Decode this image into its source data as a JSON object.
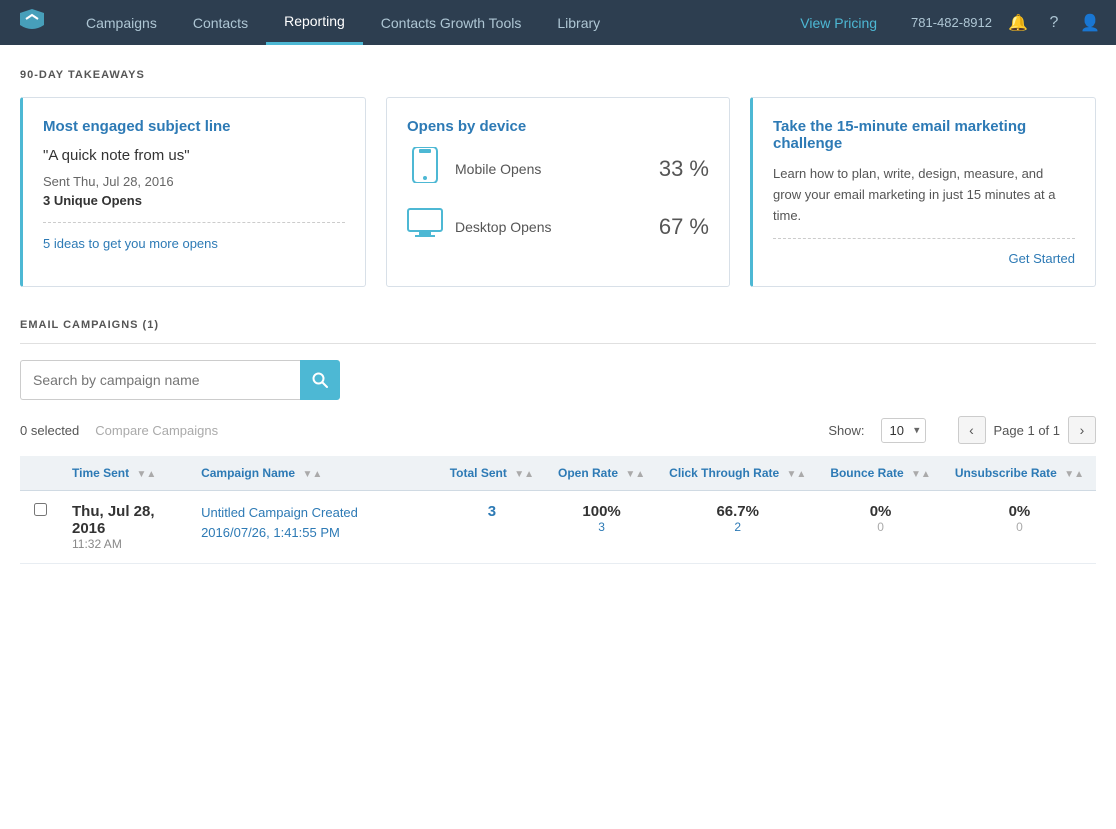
{
  "nav": {
    "logo_alt": "logo",
    "items": [
      {
        "label": "Campaigns",
        "active": false
      },
      {
        "label": "Contacts",
        "active": false
      },
      {
        "label": "Reporting",
        "active": true
      },
      {
        "label": "Contacts Growth Tools",
        "active": false
      },
      {
        "label": "Library",
        "active": false
      }
    ],
    "pricing_label": "View Pricing",
    "phone": "781-482-8912",
    "icons": [
      "bell",
      "question",
      "user"
    ]
  },
  "takeaways": {
    "section_title": "90-DAY TAKEAWAYS",
    "card1": {
      "title": "Most engaged subject line",
      "subject": "\"A quick note from us\"",
      "sent_label": "Sent Thu, Jul 28, 2016",
      "opens_label": "3 Unique Opens",
      "link": "5 ideas to get you more opens"
    },
    "card2": {
      "title": "Opens by device",
      "mobile_label": "Mobile Opens",
      "mobile_pct": "33 %",
      "desktop_label": "Desktop Opens",
      "desktop_pct": "67 %"
    },
    "card3": {
      "title": "Take the 15-minute email marketing challenge",
      "desc": "Learn how to plan, write, design, measure, and grow your email marketing in just 15 minutes at a time.",
      "link": "Get Started"
    }
  },
  "email_campaigns": {
    "section_title": "EMAIL CAMPAIGNS (1)",
    "search_placeholder": "Search by campaign name",
    "selected_count": "0 selected",
    "compare_label": "Compare Campaigns",
    "show_label": "Show:",
    "show_value": "10",
    "page_info": "Page 1 of 1",
    "columns": [
      {
        "label": "Time Sent",
        "sortable": true
      },
      {
        "label": "Campaign Name",
        "sortable": true
      },
      {
        "label": "Total Sent",
        "sortable": true
      },
      {
        "label": "Open Rate",
        "sortable": true
      },
      {
        "label": "Click Through Rate",
        "sortable": true
      },
      {
        "label": "Bounce Rate",
        "sortable": true
      },
      {
        "label": "Unsubscribe Rate",
        "sortable": true
      }
    ],
    "rows": [
      {
        "date": "Thu, Jul 28, 2016",
        "time": "11:32 AM",
        "campaign_name": "Untitled Campaign Created 2016/07/26, 1:41:55 PM",
        "total_sent_main": "3",
        "total_sent_sub": "",
        "open_rate_main": "100%",
        "open_rate_sub": "3",
        "ctr_main": "66.7%",
        "ctr_sub": "2",
        "bounce_main": "0%",
        "bounce_sub": "0",
        "unsub_main": "0%",
        "unsub_sub": "0"
      }
    ]
  }
}
